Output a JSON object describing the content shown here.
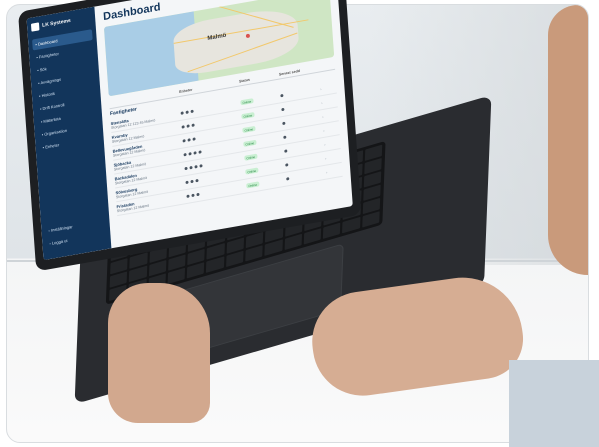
{
  "app": {
    "brand_name": "LK Systems",
    "user_initials": ""
  },
  "sidebar": {
    "items": [
      {
        "label": "Dashboard",
        "icon": "home-icon",
        "active": true
      },
      {
        "label": "Fastigheter",
        "icon": "building-icon",
        "active": false
      },
      {
        "label": "Sök",
        "icon": "search-icon",
        "active": false
      },
      {
        "label": "Avvägnings",
        "icon": "list-icon",
        "active": false
      },
      {
        "label": "Historik",
        "icon": "clock-icon",
        "active": false
      },
      {
        "label": "Drift Kontroll",
        "icon": "gauge-icon",
        "active": false
      },
      {
        "label": "Mätarlista",
        "icon": "meter-icon",
        "active": false
      },
      {
        "label": "Organisation",
        "icon": "org-icon",
        "active": false
      },
      {
        "label": "Enheter",
        "icon": "device-icon",
        "active": false
      }
    ],
    "bottom_items": [
      {
        "label": "Inställningar",
        "icon": "gear-icon"
      },
      {
        "label": "Logga ut",
        "icon": "logout-icon"
      }
    ]
  },
  "main": {
    "title": "Dashboard",
    "map": {
      "city_label": "Malmö"
    },
    "table": {
      "section_title": "Fastigheter",
      "columns": [
        "",
        "Enheter",
        "Status",
        "Senast sedd",
        ""
      ],
      "rows": [
        {
          "name": "Stensätta",
          "sub": "Storgatan 12 123 45 Malmö",
          "status": "Online",
          "dots": 3,
          "seen_dots": 1
        },
        {
          "name": "Kvarnby",
          "sub": "Storgatan 12 Malmö",
          "status": "Online",
          "dots": 3,
          "seen_dots": 1
        },
        {
          "name": "Bellevuegården",
          "sub": "Storgatan 12 Malmö",
          "status": "Online",
          "dots": 3,
          "seen_dots": 1
        },
        {
          "name": "Sjöbacka",
          "sub": "Storgatan 12 Malmö",
          "status": "Online",
          "dots": 4,
          "seen_dots": 1
        },
        {
          "name": "Backadalen",
          "sub": "Storgatan 12 Malmö",
          "status": "Online",
          "dots": 4,
          "seen_dots": 1
        },
        {
          "name": "Sölvesborg",
          "sub": "Storgatan 12 Malmö",
          "status": "Online",
          "dots": 3,
          "seen_dots": 1
        },
        {
          "name": "Fristaden",
          "sub": "Storgatan 12 Malmö",
          "status": "Online",
          "dots": 3,
          "seen_dots": 1
        }
      ]
    }
  },
  "colors": {
    "sidebar_bg": "#12355b",
    "title": "#12355b",
    "status_ok_bg": "#c9efd2",
    "status_ok_text": "#2b8a48"
  }
}
